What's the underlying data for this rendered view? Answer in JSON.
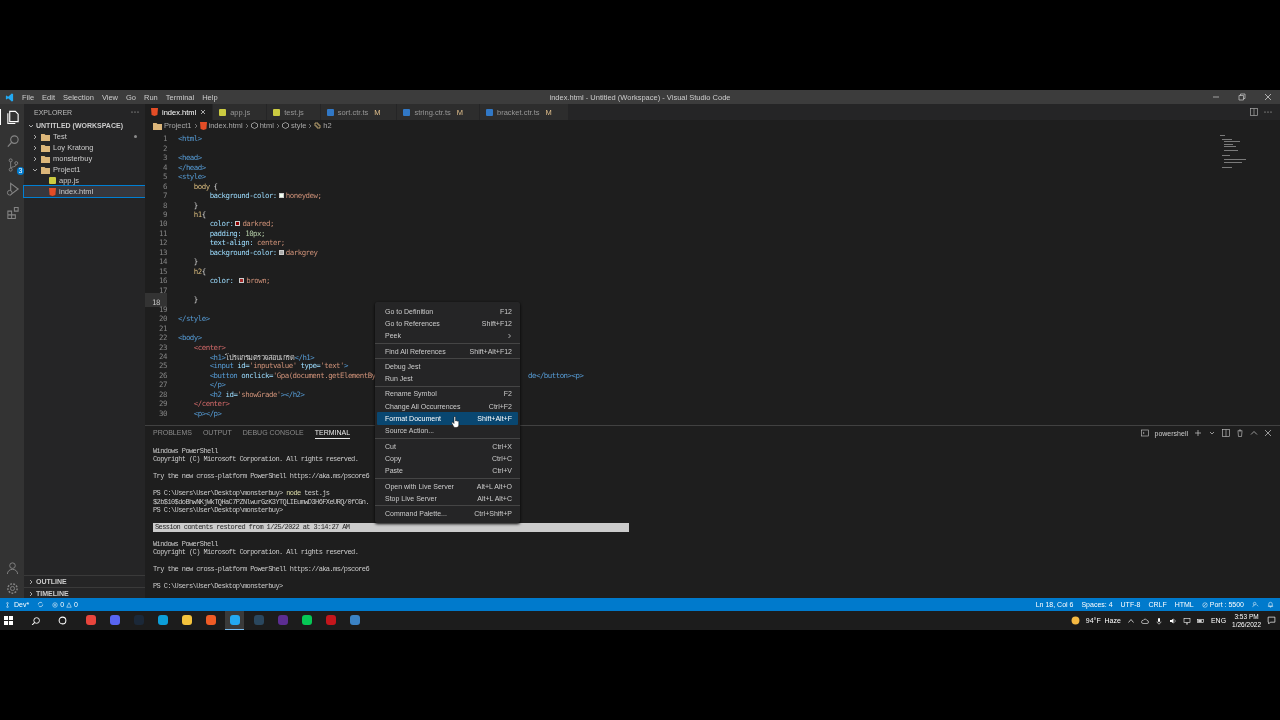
{
  "window": {
    "title": "index.html - Untitled (Workspace) - Visual Studio Code"
  },
  "menu_bar": [
    "File",
    "Edit",
    "Selection",
    "View",
    "Go",
    "Run",
    "Terminal",
    "Help"
  ],
  "activity_bar": [
    {
      "kind": "files",
      "selected": true
    },
    {
      "kind": "search",
      "selected": false
    },
    {
      "kind": "source-control",
      "selected": false,
      "badge": "3"
    },
    {
      "kind": "run",
      "selected": false
    },
    {
      "kind": "extensions",
      "selected": false
    }
  ],
  "sidebar": {
    "title": "EXPLORER",
    "workspace": "UNTITLED (WORKSPACE)",
    "tree": [
      {
        "label": "Test",
        "kind": "folder",
        "expanded": false,
        "selected": false,
        "modified": true
      },
      {
        "label": "Loy Kratong",
        "kind": "folder",
        "expanded": false,
        "selected": false,
        "modified": false
      },
      {
        "label": "monsterbuy",
        "kind": "folder",
        "expanded": false,
        "selected": false,
        "modified": false
      },
      {
        "label": "Project1",
        "kind": "folder",
        "expanded": true,
        "selected": false,
        "modified": false,
        "children": [
          {
            "label": "app.js",
            "kind": "js",
            "selected": false,
            "modified": false
          },
          {
            "label": "index.html",
            "kind": "html",
            "selected": true,
            "modified": false
          }
        ]
      }
    ],
    "sections": [
      "OUTLINE",
      "TIMELINE"
    ]
  },
  "tabs": [
    {
      "label": "index.html",
      "kind": "html",
      "selected": true
    },
    {
      "label": "app.js",
      "kind": "js",
      "selected": false
    },
    {
      "label": "test.js",
      "kind": "js",
      "selected": false
    },
    {
      "label": "sort.ctr.ts",
      "kind": "ts",
      "selected": false,
      "status": "M"
    },
    {
      "label": "string.ctr.ts",
      "kind": "ts",
      "selected": false,
      "status": "M"
    },
    {
      "label": "bracket.ctr.ts",
      "kind": "ts",
      "selected": false,
      "status": "M"
    }
  ],
  "breadcrumbs": [
    {
      "label": "Project1",
      "kind": "folder"
    },
    {
      "label": "index.html",
      "kind": "html"
    },
    {
      "label": "html",
      "kind": "element"
    },
    {
      "label": "style",
      "kind": "element"
    },
    {
      "label": "h2",
      "kind": "selector"
    }
  ],
  "code": {
    "lines": [
      {
        "number": "1",
        "active": false,
        "tokens": [
          {
            "t": "<html>",
            "kind": "tag"
          }
        ]
      },
      {
        "number": "2",
        "active": false
      },
      {
        "number": "3",
        "active": false,
        "tokens": [
          {
            "t": "<head>",
            "kind": "tag"
          }
        ]
      },
      {
        "number": "4",
        "active": false,
        "tokens": [
          {
            "t": "</head>",
            "kind": "tag"
          }
        ]
      },
      {
        "number": "5",
        "active": false,
        "tokens": [
          {
            "t": "<style>",
            "kind": "tag"
          }
        ]
      },
      {
        "number": "6",
        "active": false,
        "tokens": [
          {
            "t": "    body",
            "kind": "selector"
          },
          {
            "t": " {",
            "kind": "punct"
          }
        ]
      },
      {
        "number": "7",
        "active": false,
        "tokens": [
          {
            "t": "        background-color:",
            "kind": "prop"
          },
          {
            "kind": "swatch",
            "color": "#f0fff0"
          },
          {
            "t": "honeydew;",
            "kind": "value"
          }
        ]
      },
      {
        "number": "8",
        "active": false,
        "tokens": [
          {
            "t": "    }",
            "kind": "punct"
          }
        ]
      },
      {
        "number": "9",
        "active": false,
        "tokens": [
          {
            "t": "    h1",
            "kind": "selector"
          },
          {
            "t": "{",
            "kind": "punct"
          }
        ]
      },
      {
        "number": "10",
        "active": false,
        "tokens": [
          {
            "t": "        color:",
            "kind": "prop"
          },
          {
            "kind": "swatch",
            "color": "#8b0000"
          },
          {
            "t": "darkred;",
            "kind": "value"
          }
        ]
      },
      {
        "number": "11",
        "active": false,
        "tokens": [
          {
            "t": "        padding: ",
            "kind": "prop"
          },
          {
            "t": "10px;",
            "kind": "number"
          }
        ]
      },
      {
        "number": "12",
        "active": false,
        "tokens": [
          {
            "t": "        text-align: ",
            "kind": "prop"
          },
          {
            "t": "center;",
            "kind": "value"
          }
        ]
      },
      {
        "number": "13",
        "active": false,
        "tokens": [
          {
            "t": "        background-color:",
            "kind": "prop"
          },
          {
            "kind": "swatch",
            "color": "#a9a9a9"
          },
          {
            "t": "darkgrey",
            "kind": "value"
          }
        ]
      },
      {
        "number": "14",
        "active": false,
        "tokens": [
          {
            "t": "    }",
            "kind": "punct"
          }
        ]
      },
      {
        "number": "15",
        "active": false,
        "tokens": [
          {
            "t": "    h2",
            "kind": "selector"
          },
          {
            "t": "{",
            "kind": "punct"
          }
        ]
      },
      {
        "number": "16",
        "active": false,
        "tokens": [
          {
            "t": "        color: ",
            "kind": "prop"
          },
          {
            "kind": "swatch",
            "color": "#a52a2a"
          },
          {
            "t": "brown;",
            "kind": "value"
          }
        ]
      },
      {
        "number": "17",
        "active": false
      },
      {
        "number": "18",
        "active": true,
        "tokens": [
          {
            "t": "    }",
            "kind": "punct"
          }
        ]
      },
      {
        "number": "19",
        "active": false
      },
      {
        "number": "20",
        "active": false,
        "tokens": [
          {
            "t": "</style>",
            "kind": "tag"
          }
        ]
      },
      {
        "number": "21",
        "active": false
      },
      {
        "number": "22",
        "active": false,
        "tokens": [
          {
            "t": "<body>",
            "kind": "tag"
          }
        ]
      },
      {
        "number": "23",
        "active": false,
        "tokens": [
          {
            "t": "    <center>",
            "kind": "tag2"
          }
        ]
      },
      {
        "number": "24",
        "active": false,
        "tokens": [
          {
            "t": "        <h1>",
            "kind": "tag"
          },
          {
            "t": "โปรแกรมตรวจสอบเกรด",
            "kind": "text"
          },
          {
            "t": "</h1>",
            "kind": "tag"
          }
        ]
      },
      {
        "number": "25",
        "active": false,
        "tokens": [
          {
            "t": "        <input",
            "kind": "tag"
          },
          {
            "t": " id=",
            "kind": "attr"
          },
          {
            "t": "'inputvalue'",
            "kind": "string"
          },
          {
            "t": " type=",
            "kind": "attr"
          },
          {
            "t": "'text'",
            "kind": "string"
          },
          {
            "t": ">",
            "kind": "tag"
          }
        ]
      },
      {
        "number": "26",
        "active": false,
        "tokens": [
          {
            "t": "        <button",
            "kind": "tag"
          },
          {
            "t": " onclick=",
            "kind": "attr"
          },
          {
            "t": "'Gpa(document.getElementBy",
            "kind": "string"
          }
        ],
        "tail": "de</button><p>"
      },
      {
        "number": "27",
        "active": false,
        "tokens": [
          {
            "t": "        </p>",
            "kind": "tag"
          }
        ]
      },
      {
        "number": "28",
        "active": false,
        "tokens": [
          {
            "t": "        <h2",
            "kind": "tag"
          },
          {
            "t": " id=",
            "kind": "attr"
          },
          {
            "t": "'showGrade'",
            "kind": "string"
          },
          {
            "t": "></h2>",
            "kind": "tag"
          }
        ]
      },
      {
        "number": "29",
        "active": false,
        "tokens": [
          {
            "t": "    </center>",
            "kind": "tag2"
          }
        ]
      },
      {
        "number": "30",
        "active": false,
        "tokens": [
          {
            "t": "    <p></p>",
            "kind": "tag"
          }
        ]
      }
    ]
  },
  "panel": {
    "tabs": [
      {
        "label": "PROBLEMS",
        "selected": false
      },
      {
        "label": "OUTPUT",
        "selected": false
      },
      {
        "label": "DEBUG CONSOLE",
        "selected": false
      },
      {
        "label": "TERMINAL",
        "selected": true
      }
    ],
    "terminal_name": "powershell",
    "terminal": [
      {
        "kind": "text",
        "text": "Windows PowerShell"
      },
      {
        "kind": "text",
        "text": "Copyright (C) Microsoft Corporation. All rights reserved."
      },
      {
        "kind": "blank"
      },
      {
        "kind": "text",
        "text": "Try the new cross-platform PowerShell https://aka.ms/pscore6"
      },
      {
        "kind": "blank"
      },
      {
        "kind": "command",
        "prompt": "PS C:\\Users\\User\\Desktop\\monsterbuy> ",
        "command": "node",
        "args": " test.js"
      },
      {
        "kind": "text",
        "text": "$2b$10$doBhwNKjWkTQHaC7PZNlwurGzK3YTQLIEumwD3H6FXeURQ/0fCGn."
      },
      {
        "kind": "text",
        "text": "PS C:\\Users\\User\\Desktop\\monsterbuy>"
      },
      {
        "kind": "blank"
      },
      {
        "kind": "banner",
        "text": "Session contents restored from 1/25/2022 at 3:14:27 AM"
      },
      {
        "kind": "blank"
      },
      {
        "kind": "text",
        "text": "Windows PowerShell"
      },
      {
        "kind": "text",
        "text": "Copyright (C) Microsoft Corporation. All rights reserved."
      },
      {
        "kind": "blank"
      },
      {
        "kind": "text",
        "text": "Try the new cross-platform PowerShell https://aka.ms/pscore6"
      },
      {
        "kind": "blank"
      },
      {
        "kind": "text",
        "text": "PS C:\\Users\\User\\Desktop\\monsterbuy>"
      }
    ]
  },
  "context_menu": [
    [
      {
        "label": "Go to Definition",
        "shortcut": "F12",
        "selected": false,
        "submenu": false
      },
      {
        "label": "Go to References",
        "shortcut": "Shift+F12",
        "selected": false,
        "submenu": false
      },
      {
        "label": "Peek",
        "selected": false,
        "submenu": true
      }
    ],
    [
      {
        "label": "Find All References",
        "shortcut": "Shift+Alt+F12",
        "selected": false,
        "submenu": false
      }
    ],
    [
      {
        "label": "Debug Jest",
        "selected": false,
        "submenu": false
      },
      {
        "label": "Run Jest",
        "selected": false,
        "submenu": false
      }
    ],
    [
      {
        "label": "Rename Symbol",
        "shortcut": "F2",
        "selected": false,
        "submenu": false
      },
      {
        "label": "Change All Occurrences",
        "shortcut": "Ctrl+F2",
        "selected": false,
        "submenu": false
      },
      {
        "label": "Format Document",
        "shortcut": "Shift+Alt+F",
        "selected": true,
        "submenu": false
      },
      {
        "label": "Source Action...",
        "selected": false,
        "submenu": false
      }
    ],
    [
      {
        "label": "Cut",
        "shortcut": "Ctrl+X",
        "selected": false,
        "submenu": false
      },
      {
        "label": "Copy",
        "shortcut": "Ctrl+C",
        "selected": false,
        "submenu": false
      },
      {
        "label": "Paste",
        "shortcut": "Ctrl+V",
        "selected": false,
        "submenu": false
      }
    ],
    [
      {
        "label": "Open with Live Server",
        "shortcut": "Alt+L Alt+O",
        "selected": false,
        "submenu": false
      },
      {
        "label": "Stop Live Server",
        "shortcut": "Alt+L Alt+C",
        "selected": false,
        "submenu": false
      }
    ],
    [
      {
        "label": "Command Palette...",
        "shortcut": "Ctrl+Shift+P",
        "selected": false,
        "submenu": false
      }
    ]
  ],
  "status_bar": {
    "branch": "Dev*",
    "errors": "0",
    "warnings": "0",
    "right": [
      "Ln 18, Col 6",
      "Spaces: 4",
      "UTF-8",
      "CRLF",
      "HTML"
    ],
    "port": "Port : 5500"
  },
  "taskbar": {
    "apps": [
      {
        "color": "#e8453c",
        "selected": false
      },
      {
        "color": "#5865f2",
        "selected": false
      },
      {
        "color": "#1b2838",
        "selected": false
      },
      {
        "color": "#0c9ed8",
        "selected": false
      },
      {
        "color": "#f3c23c",
        "selected": false
      },
      {
        "color": "#ef5b25",
        "selected": false
      },
      {
        "color": "#23a9f2",
        "selected": true
      },
      {
        "color": "#2a475e",
        "selected": false
      },
      {
        "color": "#5c2d91",
        "selected": false
      },
      {
        "color": "#06c755",
        "selected": false
      },
      {
        "color": "#c4161c",
        "selected": false
      },
      {
        "color": "#3b82c4",
        "selected": false
      }
    ],
    "weather": "94°F  Haze",
    "language": "ENG",
    "time": "3:53 PM",
    "date": "1/26/2022"
  }
}
